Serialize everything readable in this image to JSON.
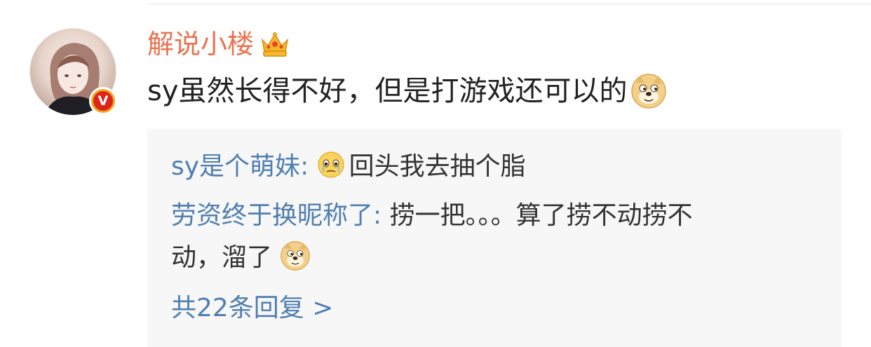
{
  "comment": {
    "username": "解说小楼",
    "text": "sy虽然长得不好，但是打游戏还可以的",
    "emoji_icon": "doge-emoji-icon",
    "badge_icon": "vip-crown-icon",
    "verified_icon": "verified-v-icon",
    "verified_label": "V"
  },
  "replies": [
    {
      "name": "sy是个萌妹",
      "sep": ": ",
      "emoji_icon": "teary-face-icon",
      "text": "回头我去抽个脂"
    },
    {
      "name": "劳资终于换昵称了",
      "sep": ": ",
      "text_line1": "捞一把。。。算了捞不动捞不",
      "text_line2": "动，溜了",
      "emoji_icon": "doge-emoji-icon"
    }
  ],
  "more_replies": "共22条回复 >",
  "colors": {
    "username": "#eb7350",
    "link": "#4f7fb1",
    "reply_bg": "#f7f7f7",
    "text": "#222222"
  }
}
